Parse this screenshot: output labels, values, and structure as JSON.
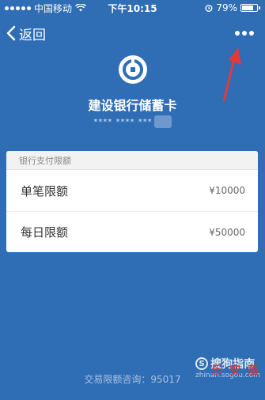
{
  "status_bar": {
    "carrier": "中国移动",
    "time": "下午10:15",
    "battery": "79%",
    "battery_level": 0.79
  },
  "nav": {
    "back_label": "返回",
    "more_icon": "more-dots-icon"
  },
  "card": {
    "bank_name": "建设银行储蓄卡",
    "card_number": "**** **** ***"
  },
  "limits": {
    "header": "银行支付限额",
    "rows": [
      {
        "label": "单笔限额",
        "value": "¥10000"
      },
      {
        "label": "每日限额",
        "value": "¥50000"
      }
    ]
  },
  "footer": {
    "text": "交易限额咨询：95017"
  },
  "watermark": {
    "title": "搜狗指南",
    "url": "zhinan.sogou.com",
    "stamp": "乐 安 落"
  },
  "colors": {
    "background": "#2f6db5",
    "panel": "#ffffff",
    "arrow": "#e03a3a"
  }
}
